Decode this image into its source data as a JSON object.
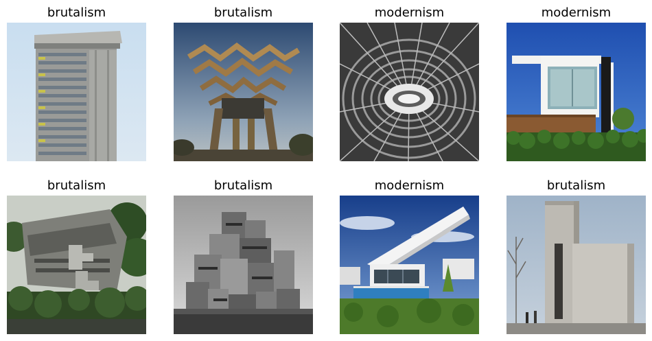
{
  "grid": {
    "items": [
      {
        "label": "brutalism"
      },
      {
        "label": "brutalism"
      },
      {
        "label": "modernism"
      },
      {
        "label": "modernism"
      },
      {
        "label": "brutalism"
      },
      {
        "label": "brutalism"
      },
      {
        "label": "modernism"
      },
      {
        "label": "brutalism"
      }
    ]
  }
}
